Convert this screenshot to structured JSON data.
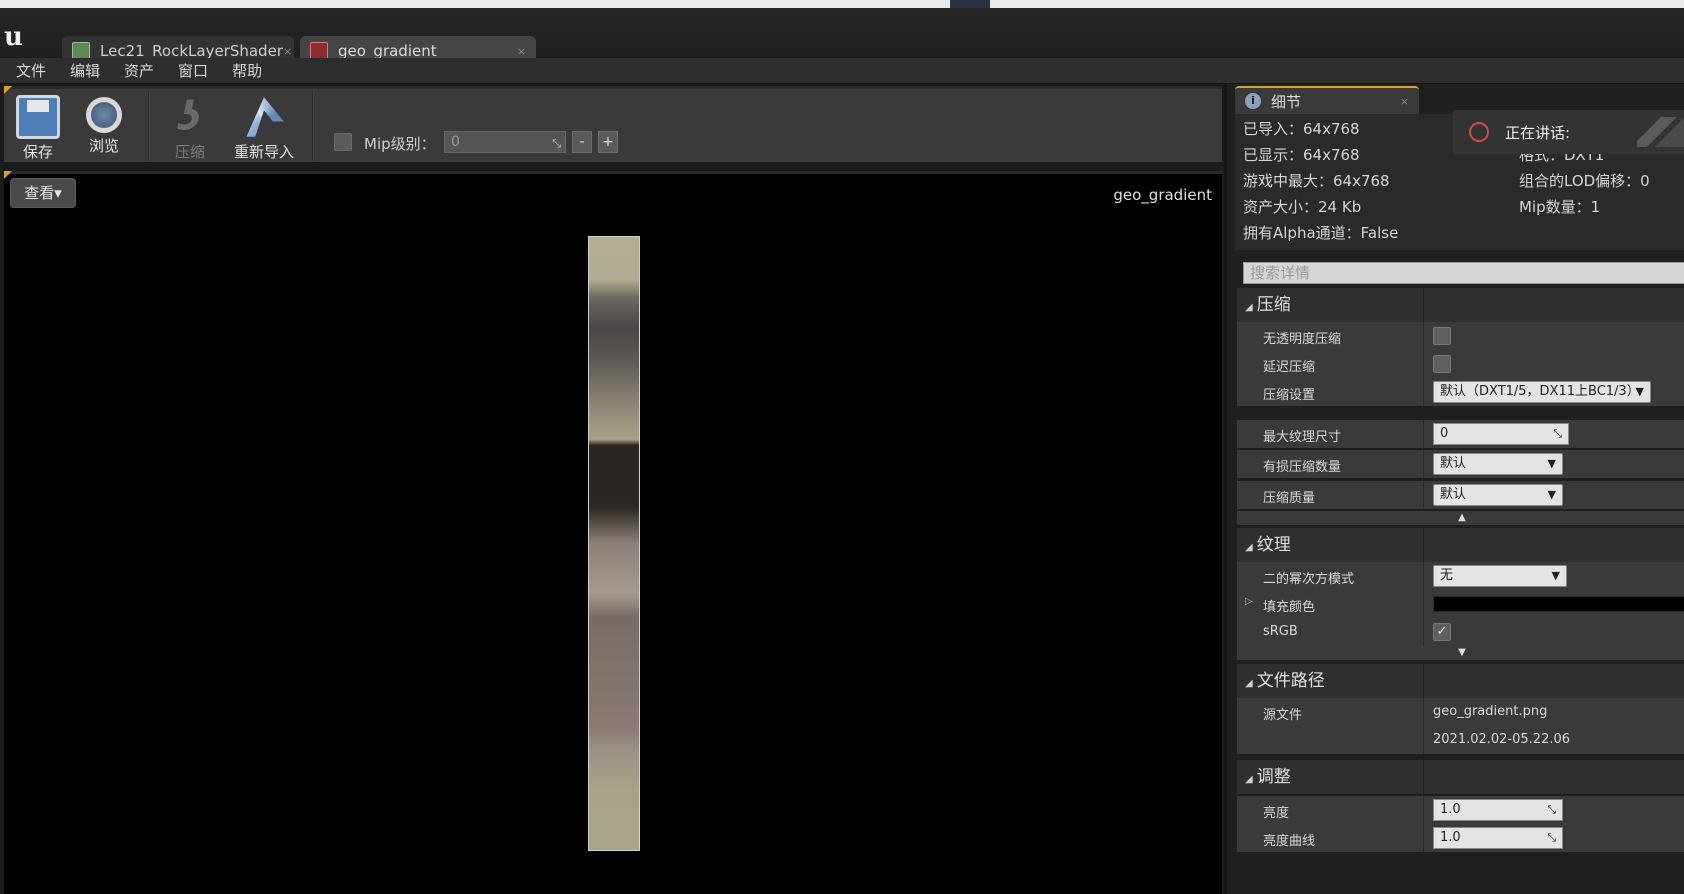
{
  "tabs": [
    {
      "label": "Lec21_RockLayerShader",
      "close": "×"
    },
    {
      "label": "geo_gradient",
      "close": "×"
    }
  ],
  "menu": [
    "文件",
    "编辑",
    "资产",
    "窗口",
    "帮助"
  ],
  "toolbar": {
    "save_label": "保存",
    "browse_label": "浏览",
    "compress_label": "压缩",
    "reimport_label": "重新导入",
    "mip_label": "Mip级别：",
    "mip_value": "0",
    "mip_minus": "-",
    "mip_plus": "+"
  },
  "viewport": {
    "view_button": "查看▾",
    "texture_name": "geo_gradient"
  },
  "details": {
    "tab_label": "细节",
    "tab_close": "×",
    "speaking": "正在讲话:",
    "info": {
      "imported": "已导入：64x768",
      "displayed": "已显示：64x768",
      "max_ingame": "游戏中最大：64x768",
      "asset_size": "资产大小：24 Kb",
      "has_alpha": "拥有Alpha通道：False",
      "format": "格式：DXT1",
      "lod_bias": "组合的LOD偏移：0",
      "mip_count": "Mip数量：1"
    },
    "search_placeholder": "搜索详情",
    "sections": {
      "compression": {
        "title": "压缩",
        "no_alpha_label": "无透明度压缩",
        "defer_label": "延迟压缩",
        "settings_label": "压缩设置",
        "settings_value": "默认（DXT1/5，DX11上BC1/3）",
        "max_size_label": "最大纹理尺寸",
        "max_size_value": "0",
        "lossy_label": "有损压缩数量",
        "lossy_value": "默认",
        "quality_label": "压缩质量",
        "quality_value": "默认"
      },
      "texture": {
        "title": "纹理",
        "pow2_label": "二的幂次方模式",
        "pow2_value": "无",
        "pad_color_label": "填充颜色",
        "srgb_label": "sRGB",
        "srgb_checked": "✓"
      },
      "file_path": {
        "title": "文件路径",
        "source_label": "源文件",
        "source_file": "geo_gradient.png",
        "source_date": "2021.02.02-05.22.06"
      },
      "adjust": {
        "title": "调整",
        "brightness_label": "亮度",
        "brightness_value": "1.0",
        "brightness_curve_label": "亮度曲线",
        "brightness_curve_value": "1.0"
      }
    }
  },
  "colors": {
    "accent": "#d8a21c",
    "panel": "#3a3a3a",
    "background": "#1a1a1a"
  }
}
